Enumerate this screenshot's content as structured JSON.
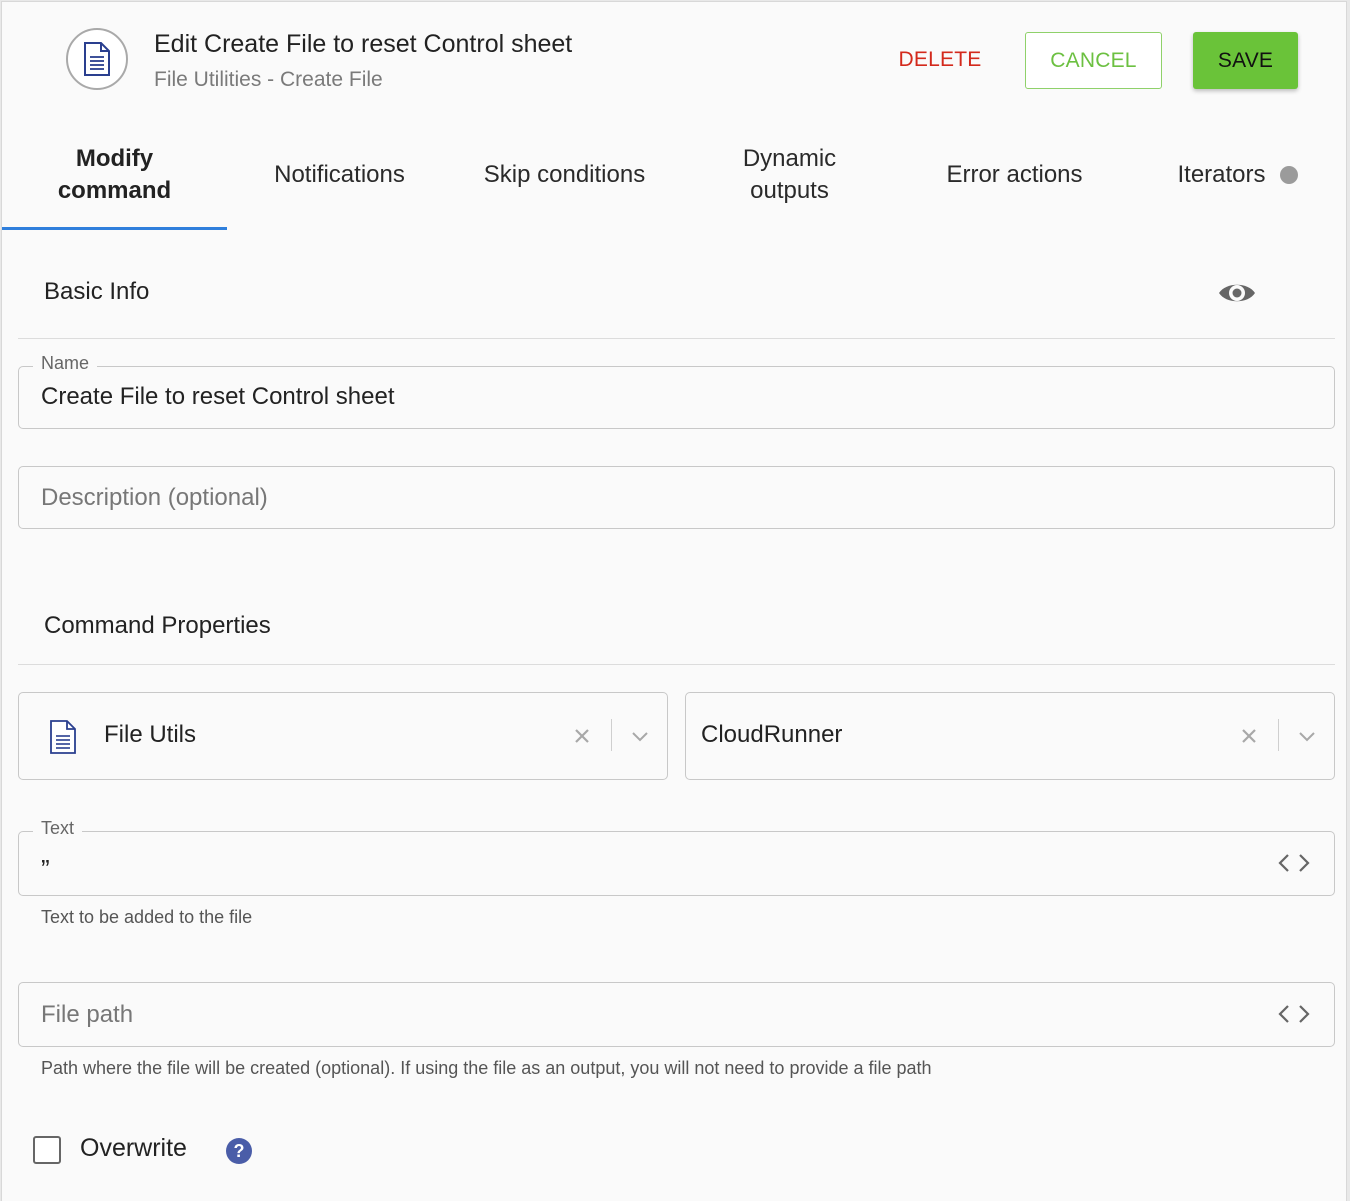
{
  "header": {
    "title": "Edit Create File to reset Control sheet",
    "subtitle": "File Utilities - Create File",
    "icon": "document-icon",
    "delete_label": "DELETE",
    "cancel_label": "CANCEL",
    "save_label": "SAVE"
  },
  "colors": {
    "accent": "#2f7fdc",
    "delete": "#d3291c",
    "save": "#6ac339",
    "help": "#4a5da8"
  },
  "tabs": [
    {
      "label_line1": "Modify",
      "label_line2": "command",
      "active": true
    },
    {
      "label": "Notifications"
    },
    {
      "label": "Skip conditions"
    },
    {
      "label_line1": "Dynamic",
      "label_line2": "outputs"
    },
    {
      "label": "Error actions"
    },
    {
      "label": "Iterators"
    }
  ],
  "basic_info": {
    "title": "Basic Info",
    "name_label": "Name",
    "name_value": "Create File to reset Control sheet",
    "description_placeholder": "Description (optional)"
  },
  "command_properties": {
    "title": "Command Properties",
    "utility_select": "File Utils",
    "runner_select": "CloudRunner",
    "text_label": "Text",
    "text_value": "”",
    "text_helper": "Text to be added to the file",
    "file_path_placeholder": "File path",
    "file_path_helper": "Path where the file will be created (optional). If using the file as an output, you will not need to provide a file path",
    "overwrite_label": "Overwrite",
    "overwrite_checked": false,
    "help_glyph": "?"
  }
}
